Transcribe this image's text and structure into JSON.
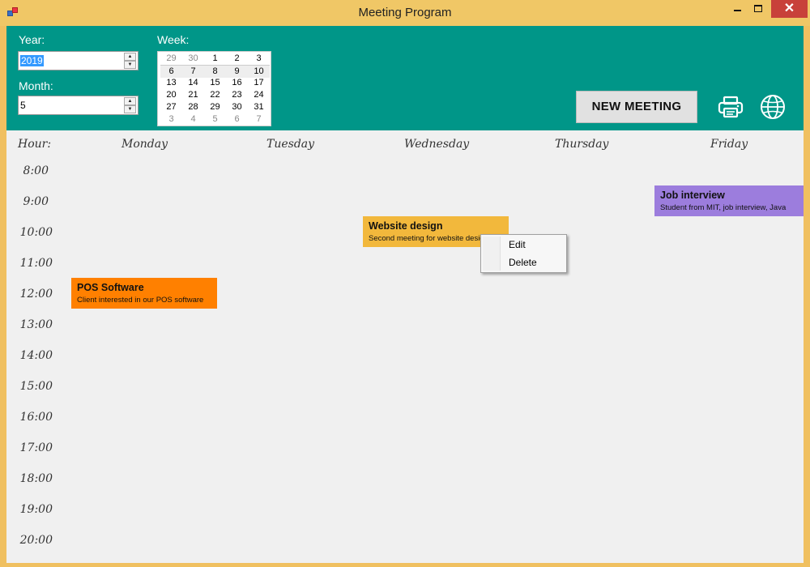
{
  "window": {
    "title": "Meeting Program",
    "close_glyph": "✕"
  },
  "header": {
    "year_label": "Year:",
    "year_value": "2019",
    "month_label": "Month:",
    "month_value": "5",
    "week_label": "Week:",
    "calendar_rows": [
      [
        {
          "d": "29",
          "dim": true
        },
        {
          "d": "30",
          "dim": true
        },
        {
          "d": "1"
        },
        {
          "d": "2"
        },
        {
          "d": "3"
        }
      ],
      [
        {
          "d": "6"
        },
        {
          "d": "7"
        },
        {
          "d": "8"
        },
        {
          "d": "9"
        },
        {
          "d": "10"
        }
      ],
      [
        {
          "d": "13"
        },
        {
          "d": "14"
        },
        {
          "d": "15"
        },
        {
          "d": "16"
        },
        {
          "d": "17"
        }
      ],
      [
        {
          "d": "20"
        },
        {
          "d": "21"
        },
        {
          "d": "22"
        },
        {
          "d": "23"
        },
        {
          "d": "24"
        }
      ],
      [
        {
          "d": "27"
        },
        {
          "d": "28"
        },
        {
          "d": "29"
        },
        {
          "d": "30"
        },
        {
          "d": "31"
        }
      ],
      [
        {
          "d": "3",
          "dim": true
        },
        {
          "d": "4",
          "dim": true
        },
        {
          "d": "5",
          "dim": true
        },
        {
          "d": "6",
          "dim": true
        },
        {
          "d": "7",
          "dim": true
        }
      ]
    ],
    "selected_week_index": 1,
    "new_meeting_label": "NEW MEETING",
    "print_icon": "printer-icon",
    "language_icon": "globe-icon",
    "bg_color": "#009688"
  },
  "schedule": {
    "hour_label": "Hour:",
    "days": [
      "Monday",
      "Tuesday",
      "Wednesday",
      "Thursday",
      "Friday"
    ],
    "hours": [
      "8:00",
      "9:00",
      "10:00",
      "11:00",
      "12:00",
      "13:00",
      "14:00",
      "15:00",
      "16:00",
      "17:00",
      "18:00",
      "19:00",
      "20:00"
    ]
  },
  "meetings": [
    {
      "title": "Job interview",
      "description": "Student from MIT, job interview, Java",
      "day": "Friday",
      "start": "9:00",
      "color": "#9c7ddd"
    },
    {
      "title": "Website design",
      "description": "Second meeting for website design",
      "day": "Wednesday",
      "start": "10:00",
      "color": "#f2b83c"
    },
    {
      "title": "POS Software",
      "description": "Client interested in our POS software",
      "day": "Monday",
      "start": "12:00",
      "color": "#ff8000"
    }
  ],
  "context_menu": {
    "items": [
      "Edit",
      "Delete"
    ]
  }
}
